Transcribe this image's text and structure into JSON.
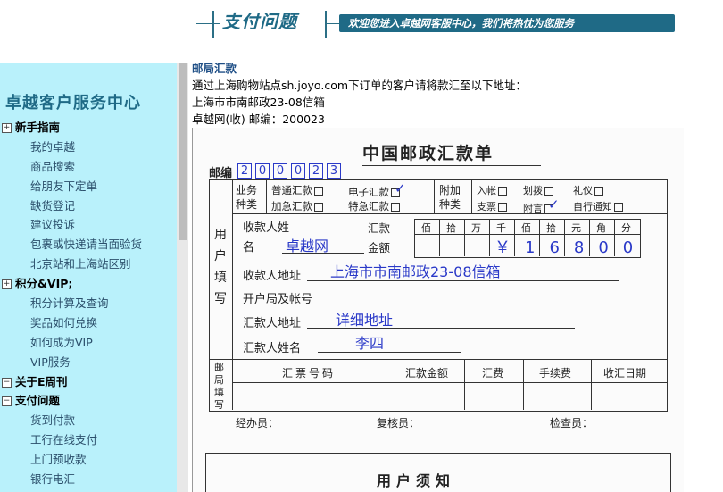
{
  "header": {
    "title": "支付问题",
    "banner": "欢迎您进入卓越网客服中心，我们将热忱为您服务"
  },
  "sidebar": {
    "brand": "卓越客户服务中心",
    "groups": [
      {
        "label": "新手指南",
        "toggle": "⊞",
        "items": [
          "我的卓越",
          "商品搜索",
          "给朋友下定单",
          "缺货登记",
          "建议投诉",
          "包裹或快递请当面验货",
          "北京站和上海站区别"
        ]
      },
      {
        "label": "积分&VIP;",
        "toggle": "⊞",
        "items": [
          "积分计算及查询",
          "奖品如何兑换",
          "如何成为VIP",
          "VIP服务"
        ]
      },
      {
        "label": "关于E周刊",
        "toggle": "⊟",
        "items": []
      },
      {
        "label": "支付问题",
        "toggle": "⊟",
        "items": [
          "货到付款",
          "工行在线支付",
          "上门预收款",
          "银行电汇"
        ]
      }
    ]
  },
  "content": {
    "section_title": "邮局汇款",
    "lines": [
      "通过上海购物站点sh.joyo.com下订单的客户请将款汇至以下地址：",
      "上海市市南邮政23-08信箱",
      "卓越网(收) 邮编：200023"
    ]
  },
  "form": {
    "title": "中国邮政汇款单",
    "zip_label": "邮编",
    "zip": [
      "2",
      "0",
      "0",
      "0",
      "2",
      "3"
    ],
    "biz_type": "业务种类",
    "biz_opts": [
      "普通汇款",
      "电子汇款",
      "加急汇款",
      "特急汇款"
    ],
    "extra": "附加种类",
    "extra_opts": [
      "入帐",
      "划拨",
      "礼仪",
      "支票",
      "附言",
      "自行通知"
    ],
    "user_fill": "用户填写",
    "payee_label": "收款人姓名",
    "payee": "卓越网",
    "amount_label": "汇款金额",
    "amount_units": [
      "佰",
      "拾",
      "万",
      "千",
      "佰",
      "拾",
      "元",
      "角",
      "分"
    ],
    "amount": "￥16800",
    "address_label": "收款人地址",
    "address": "上海市市南邮政23-08信箱",
    "bank_label": "开户局及帐号",
    "sender_addr_label": "汇款人地址",
    "sender_addr": "详细地址",
    "sender_name_label": "汇款人姓名",
    "sender_name": "李四",
    "post_fill": "邮局填写",
    "cols": [
      "汇票号码",
      "汇款金额",
      "汇费",
      "手续费",
      "收汇日期"
    ],
    "handler": "经办员：",
    "checker": "复核员：",
    "inspector": "检查员：",
    "notice": "用户须知"
  }
}
